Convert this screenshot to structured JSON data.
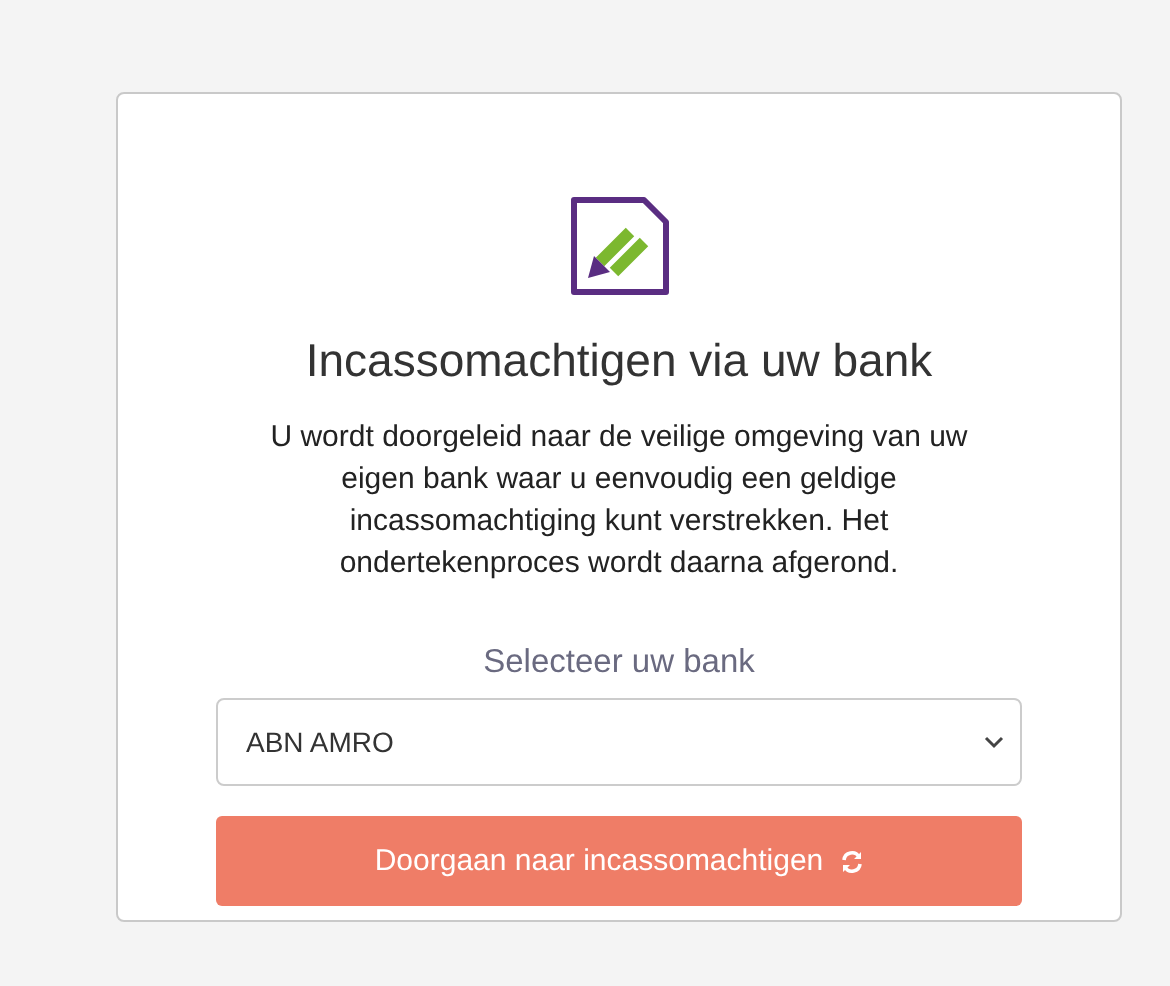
{
  "title": "Incassomachtigen via uw bank",
  "description": "U wordt doorgeleid naar de veilige omgeving van uw eigen bank waar u eenvoudig een geldige incassomachtiging kunt verstrekken. Het ondertekenproces wordt daarna afgerond.",
  "bank_select": {
    "label": "Selecteer uw bank",
    "value": "ABN AMRO"
  },
  "button": {
    "label": "Doorgaan naar incassomachtigen"
  }
}
